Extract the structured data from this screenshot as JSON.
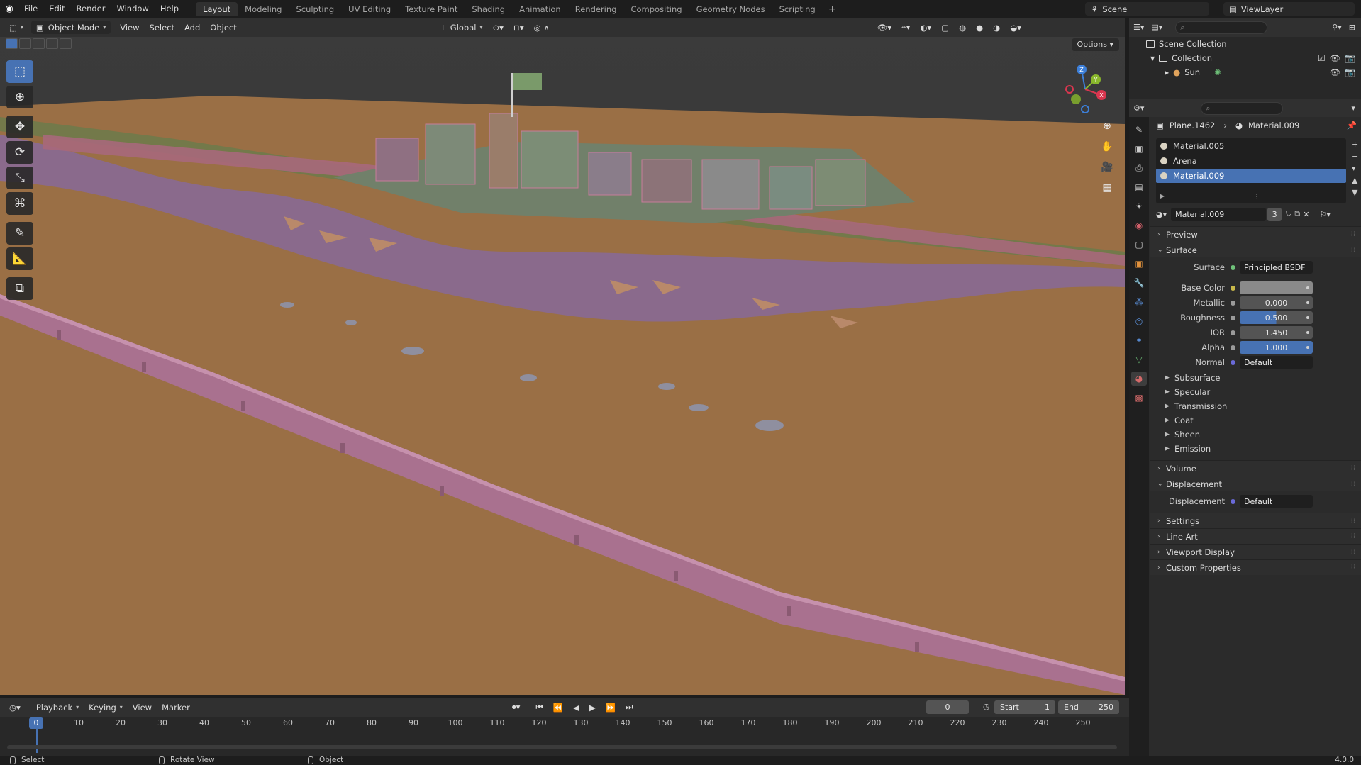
{
  "app": {
    "menus": [
      "File",
      "Edit",
      "Render",
      "Window",
      "Help"
    ],
    "workspaces": [
      "Layout",
      "Modeling",
      "Sculpting",
      "UV Editing",
      "Texture Paint",
      "Shading",
      "Animation",
      "Rendering",
      "Compositing",
      "Geometry Nodes",
      "Scripting"
    ],
    "active_workspace": "Layout",
    "scene": "Scene",
    "view_layer": "ViewLayer",
    "version": "4.0.0"
  },
  "viewport": {
    "mode": "Object Mode",
    "menus": [
      "View",
      "Select",
      "Add",
      "Object"
    ],
    "transform_orientation": "Global",
    "options_label": "Options",
    "tools": [
      "select-box",
      "cursor",
      "move",
      "rotate",
      "scale",
      "transform",
      "annotate",
      "measure",
      "add-cube"
    ],
    "gizmo_axes": [
      "Z",
      "Y",
      "X"
    ]
  },
  "outliner": {
    "root": "Scene Collection",
    "collection": "Collection",
    "object": "Sun"
  },
  "properties": {
    "breadcrumb_object": "Plane.1462",
    "breadcrumb_material": "Material.009",
    "material_slots": [
      "Material.005",
      "Arena",
      "Material.009"
    ],
    "selected_slot": "Material.009",
    "material_name": "Material.009",
    "user_count": "3",
    "panels": {
      "preview": "Preview",
      "surface": "Surface",
      "volume": "Volume",
      "displacement": "Displacement",
      "settings": "Settings",
      "line_art": "Line Art",
      "viewport_display": "Viewport Display",
      "custom_properties": "Custom Properties"
    },
    "surface": {
      "surface_label": "Surface",
      "surface_value": "Principled BSDF",
      "base_color_label": "Base Color",
      "base_color": "#8a8a8a",
      "metallic_label": "Metallic",
      "metallic": "0.000",
      "roughness_label": "Roughness",
      "roughness": "0.500",
      "ior_label": "IOR",
      "ior": "1.450",
      "alpha_label": "Alpha",
      "alpha": "1.000",
      "normal_label": "Normal",
      "normal": "Default",
      "subsections": [
        "Subsurface",
        "Specular",
        "Transmission",
        "Coat",
        "Sheen",
        "Emission"
      ]
    },
    "displacement": {
      "label": "Displacement",
      "value": "Default"
    }
  },
  "timeline": {
    "menus": [
      "Playback",
      "Keying",
      "View",
      "Marker"
    ],
    "current_frame": "0",
    "start_label": "Start",
    "start": "1",
    "end_label": "End",
    "end": "250",
    "ruler": [
      "0",
      "10",
      "20",
      "30",
      "40",
      "50",
      "60",
      "70",
      "80",
      "90",
      "100",
      "110",
      "120",
      "130",
      "140",
      "150",
      "160",
      "170",
      "180",
      "190",
      "200",
      "210",
      "220",
      "230",
      "240",
      "250"
    ]
  },
  "statusbar": {
    "select": "Select",
    "rotate_view": "Rotate View",
    "object": "Object"
  },
  "colors": {
    "accent": "#4772b3",
    "ground": "#9a6f45",
    "water": "#8a6a8c",
    "bridge": "#a9718f"
  }
}
